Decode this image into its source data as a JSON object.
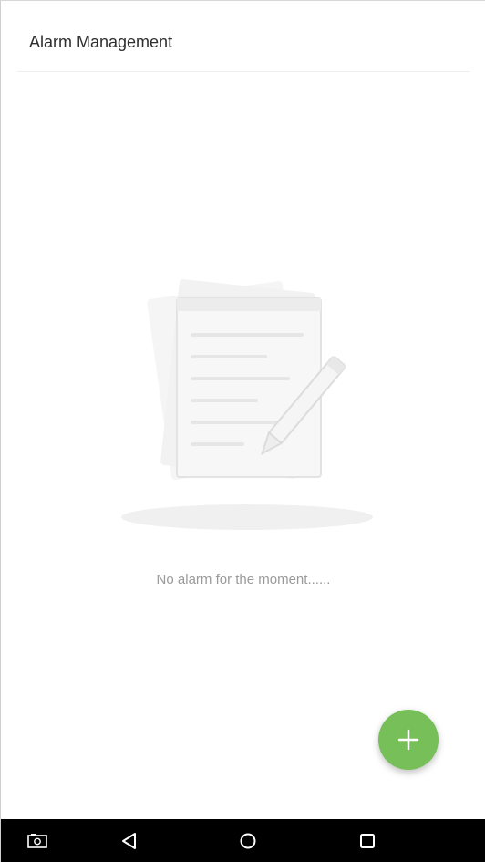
{
  "header": {
    "title": "Alarm Management"
  },
  "empty_state": {
    "icon": "notepad-pencil-icon",
    "message": "No alarm for the moment......"
  },
  "fab": {
    "icon": "plus-icon",
    "color": "#77bf59"
  },
  "nav_bar": {
    "buttons": [
      {
        "icon": "screenshot-icon"
      },
      {
        "icon": "back-triangle-icon"
      },
      {
        "icon": "home-circle-icon"
      },
      {
        "icon": "recents-square-icon"
      }
    ]
  }
}
